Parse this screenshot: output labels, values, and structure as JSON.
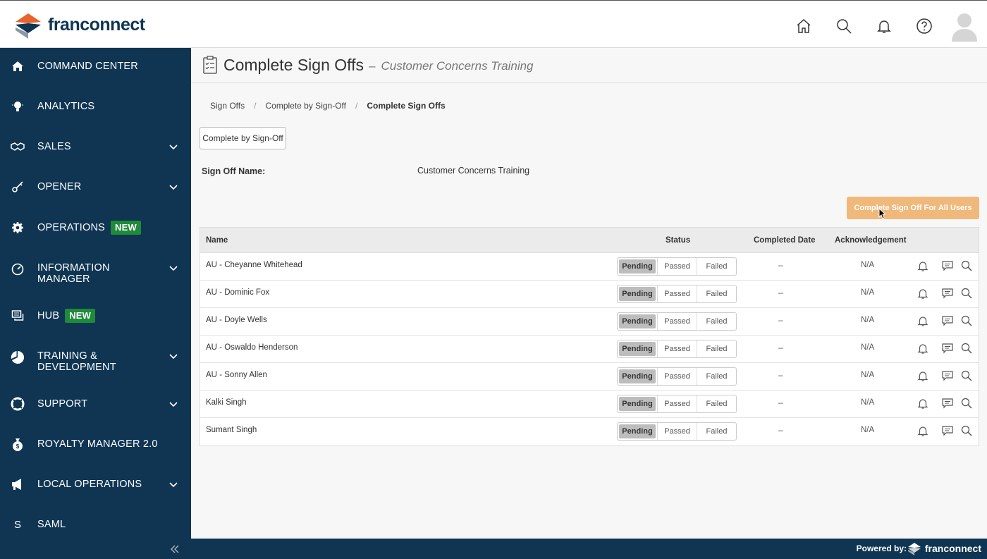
{
  "brand": {
    "name": "franconnect",
    "footer_powered": "Powered by:",
    "footer_brand": "franconnect"
  },
  "header_icons": [
    "home-icon",
    "search-icon",
    "bell-icon",
    "help-icon",
    "user-avatar"
  ],
  "sidebar": {
    "items": [
      {
        "label": "COMMAND CENTER",
        "icon": "home-icon"
      },
      {
        "label": "ANALYTICS",
        "icon": "lightbulb-icon"
      },
      {
        "label": "SALES",
        "icon": "handshake-icon",
        "expandable": true
      },
      {
        "label": "OPENER",
        "icon": "key-icon",
        "expandable": true
      },
      {
        "label": "OPERATIONS",
        "icon": "gear-icon",
        "badge": "NEW"
      },
      {
        "label": "INFORMATION",
        "label2": "MANAGER",
        "icon": "gauge-icon",
        "expandable": true
      },
      {
        "label": "HUB",
        "icon": "chat-icon",
        "badge": "NEW"
      },
      {
        "label": "TRAINING &",
        "label2": "DEVELOPMENT",
        "icon": "pie-icon",
        "expandable": true
      },
      {
        "label": "SUPPORT",
        "icon": "lifebuoy-icon",
        "expandable": true
      },
      {
        "label": "ROYALTY MANAGER 2.0",
        "icon": "money-bag-icon"
      },
      {
        "label": "LOCAL OPERATIONS",
        "icon": "megaphone-icon",
        "expandable": true
      },
      {
        "label": "SAML",
        "icon": "letter-s-icon",
        "icon_text": "S"
      }
    ]
  },
  "page": {
    "title": "Complete Sign Offs",
    "dash": "–",
    "subtitle": "Customer Concerns Training",
    "breadcrumb": [
      "Sign Offs",
      "Complete by Sign-Off",
      "Complete Sign Offs"
    ],
    "back_button": "Complete by Sign-Off",
    "field_label": "Sign Off Name:",
    "field_value": "Customer Concerns Training",
    "primary_button": "Complete Sign Off For All Users"
  },
  "table": {
    "headers": {
      "name": "Name",
      "status": "Status",
      "completed": "Completed Date",
      "ack": "Acknowledgement"
    },
    "status_options": [
      "Pending",
      "Passed",
      "Failed"
    ],
    "rows": [
      {
        "name": "AU - Cheyanne Whitehead",
        "status": "Pending",
        "completed": "–",
        "ack": "N/A"
      },
      {
        "name": "AU - Dominic Fox",
        "status": "Pending",
        "completed": "–",
        "ack": "N/A"
      },
      {
        "name": "AU - Doyle Wells",
        "status": "Pending",
        "completed": "–",
        "ack": "N/A"
      },
      {
        "name": "AU - Oswaldo Henderson",
        "status": "Pending",
        "completed": "–",
        "ack": "N/A"
      },
      {
        "name": "AU - Sonny Allen",
        "status": "Pending",
        "completed": "–",
        "ack": "N/A"
      },
      {
        "name": "Kalki Singh",
        "status": "Pending",
        "completed": "–",
        "ack": "N/A"
      },
      {
        "name": "Sumant Singh",
        "status": "Pending",
        "completed": "–",
        "ack": "N/A"
      }
    ]
  },
  "colors": {
    "sidebar": "#0f3553",
    "primary_button": "#f0b87a",
    "badge": "#1f8a3a"
  }
}
